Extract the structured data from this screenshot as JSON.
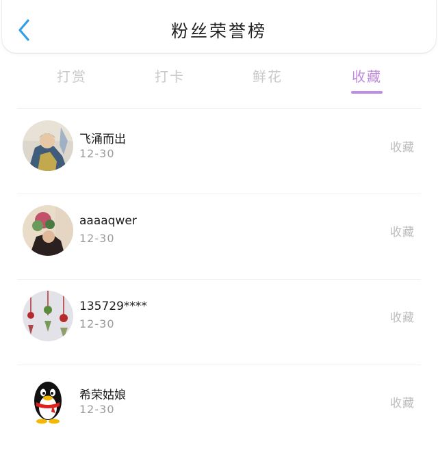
{
  "header": {
    "title": "粉丝荣誉榜"
  },
  "tabs": [
    {
      "label": "打赏"
    },
    {
      "label": "打卡"
    },
    {
      "label": "鲜花"
    },
    {
      "label": "收藏"
    }
  ],
  "active_tab": "收藏",
  "colors": {
    "accent": "#c08ee0",
    "back_arrow": "#2f9ee8",
    "inactive_tab": "#c9c9c9"
  },
  "fans": [
    {
      "name": "飞涌而出",
      "date": "12-30",
      "action": "收藏",
      "avatar": "photo-avatar"
    },
    {
      "name": "aaaaqwer",
      "date": "12-30",
      "action": "收藏",
      "avatar": "photo-avatar"
    },
    {
      "name": "135729****",
      "date": "12-30",
      "action": "收藏",
      "avatar": "photo-avatar"
    },
    {
      "name": "希荣姑娘",
      "date": "12-30",
      "action": "收藏",
      "avatar": "qq-penguin-avatar"
    }
  ]
}
